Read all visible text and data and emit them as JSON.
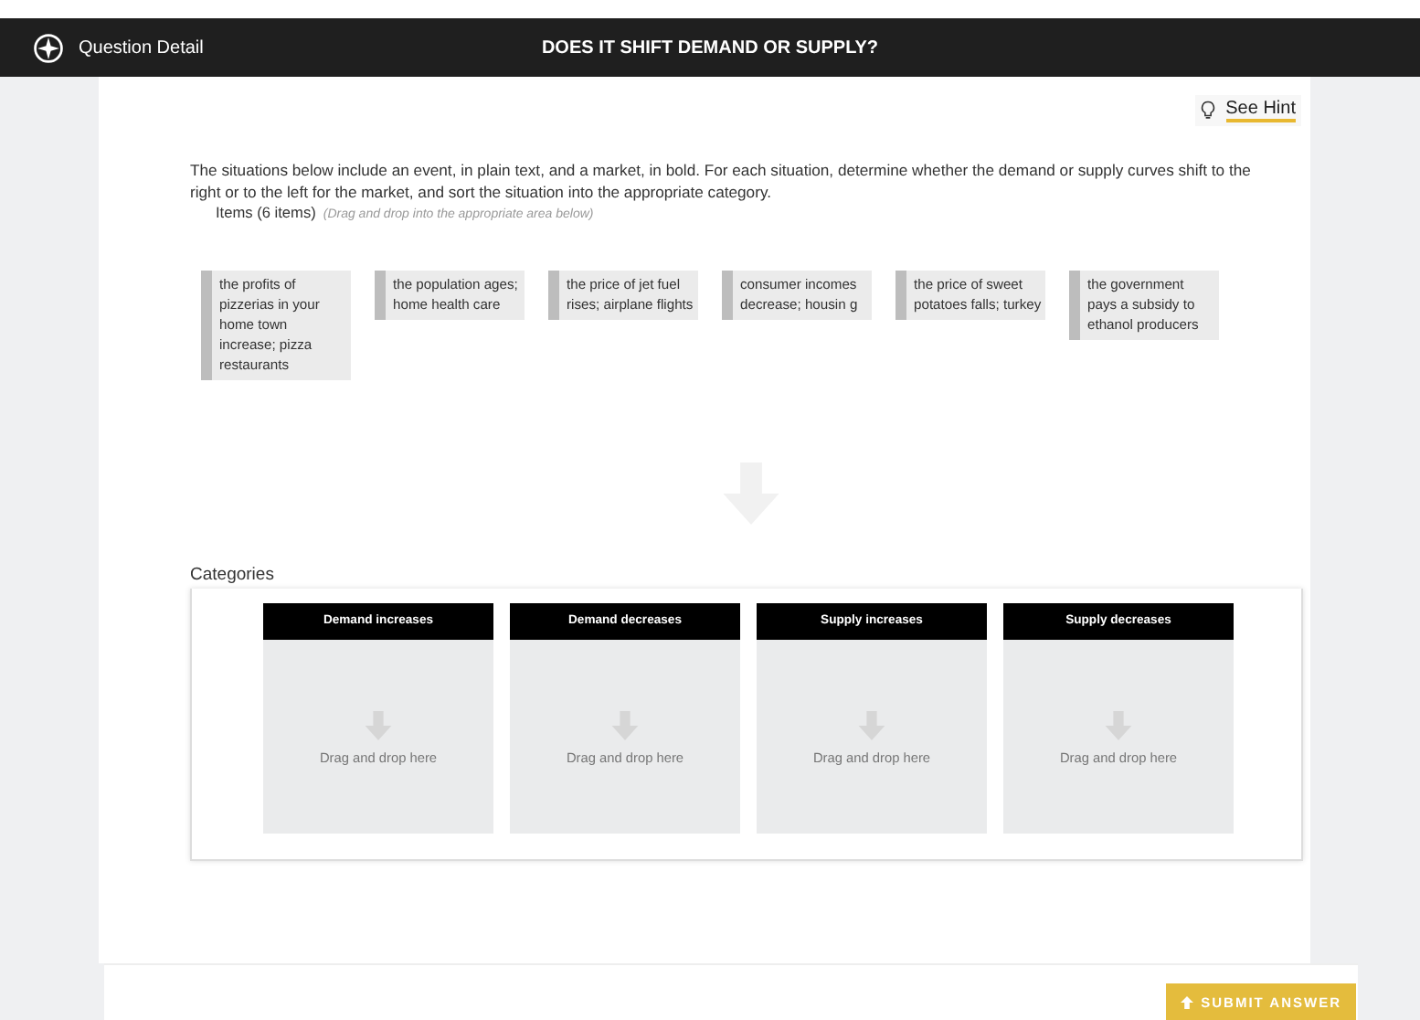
{
  "header": {
    "title": "Question Detail",
    "question_title": "DOES IT SHIFT DEMAND OR SUPPLY?"
  },
  "hint": {
    "label": "See Hint"
  },
  "instructions": "The situations below include an event, in plain text, and a market, in bold. For each situation, determine whether the demand or supply curves shift to the right or to the left for the market, and sort the situation into the appropriate category.",
  "items_heading": {
    "label": "Items (6 items)",
    "note": "(Drag and drop into the appropriate area below)"
  },
  "items": [
    {
      "text": "the profits of pizzerias in your home town increase; pizza restaurants"
    },
    {
      "text": "the population ages; home health care"
    },
    {
      "text": "the price of jet fuel rises; airplane flights"
    },
    {
      "text": "consumer incomes decrease; housin g"
    },
    {
      "text": "the price of sweet potatoes falls; turkey"
    },
    {
      "text": "the government pays a subsidy to ethanol producers"
    }
  ],
  "categories_heading": "Categories",
  "categories": [
    {
      "title": "Demand increases",
      "placeholder": "Drag and drop here"
    },
    {
      "title": "Demand decreases",
      "placeholder": "Drag and drop here"
    },
    {
      "title": "Supply increases",
      "placeholder": "Drag and drop here"
    },
    {
      "title": "Supply decreases",
      "placeholder": "Drag and drop here"
    }
  ],
  "submit_button": {
    "label": "SUBMIT ANSWER"
  }
}
